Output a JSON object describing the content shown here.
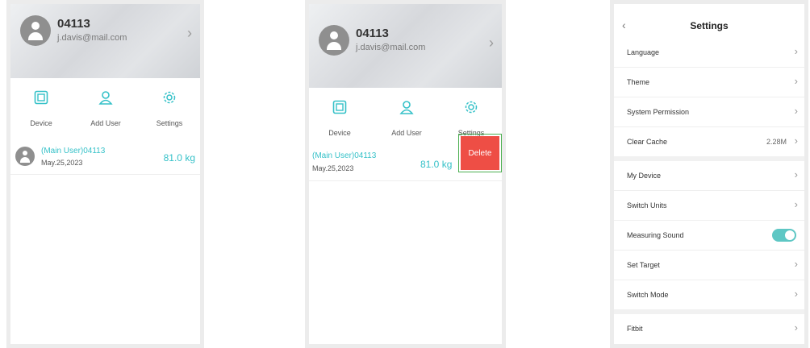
{
  "accent_color": "#35c1c8",
  "delete_color": "#ee4e45",
  "profile": {
    "name": "04113",
    "email": "j.davis@mail.com"
  },
  "actions": [
    {
      "label": "Device",
      "icon": "device-icon"
    },
    {
      "label": "Add User",
      "icon": "add-user-icon"
    },
    {
      "label": "Settings",
      "icon": "gear-icon"
    }
  ],
  "user_record": {
    "name": "(Main User)04113",
    "date": "May.25,2023",
    "weight": "81.0 kg"
  },
  "delete_label": "Delete",
  "settings": {
    "title": "Settings",
    "items": [
      {
        "label": "Language"
      },
      {
        "label": "Theme"
      },
      {
        "label": "System Permission"
      },
      {
        "label": "Clear Cache",
        "value": "2.28M"
      },
      {
        "label": "My Device"
      },
      {
        "label": "Switch Units"
      },
      {
        "label": "Measuring Sound",
        "toggle_on": true
      },
      {
        "label": "Set Target"
      },
      {
        "label": "Switch Mode"
      },
      {
        "label": "Fitbit"
      }
    ]
  }
}
